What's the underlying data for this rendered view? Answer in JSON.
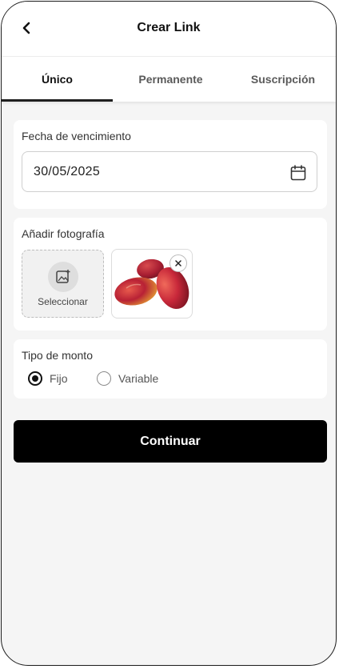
{
  "header": {
    "title": "Crear Link",
    "back_icon": "chevron-left-icon"
  },
  "tabs": [
    {
      "label": "Único",
      "active": true
    },
    {
      "label": "Permanente",
      "active": false
    },
    {
      "label": "Suscripción",
      "active": false
    }
  ],
  "expiry": {
    "label": "Fecha de vencimiento",
    "value": "30/05/2025",
    "icon": "calendar-icon"
  },
  "photo": {
    "label": "Añadir fotografía",
    "select_label": "Seleccionar",
    "select_icon": "add-image-icon",
    "remove_icon": "close-icon",
    "image_subject": "mangoes"
  },
  "amount_type": {
    "label": "Tipo de monto",
    "options": [
      {
        "label": "Fijo",
        "selected": true
      },
      {
        "label": "Variable",
        "selected": false
      }
    ]
  },
  "continue_label": "Continuar",
  "colors": {
    "primary": "#000000",
    "background": "#f5f5f5",
    "card": "#ffffff",
    "mango_red": "#c8283a",
    "mango_yellow": "#e8a733"
  }
}
